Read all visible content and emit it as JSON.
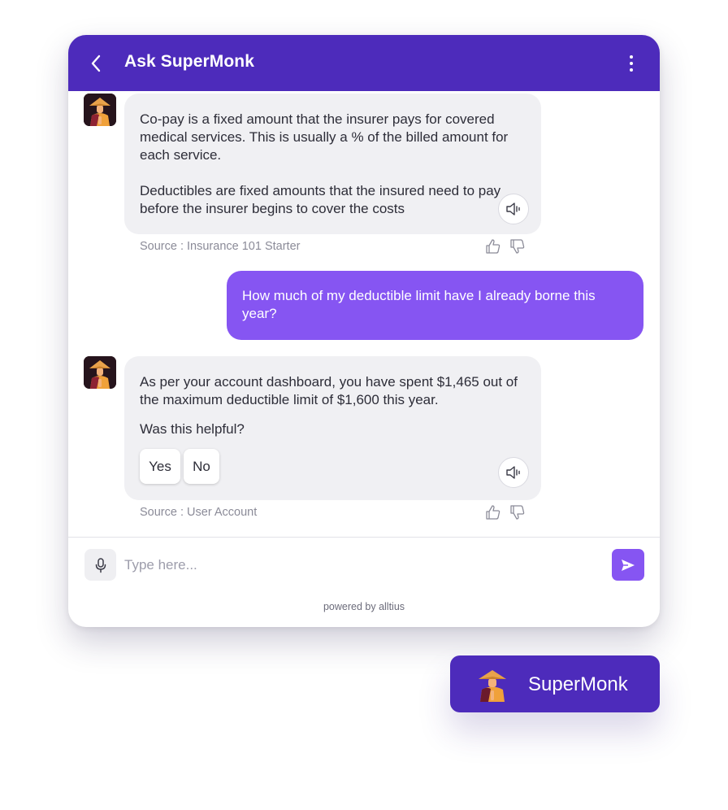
{
  "header": {
    "title": "Ask SuperMonk",
    "back_icon": "chevron-left-icon",
    "menu_icon": "more-vertical-icon",
    "color": "#4d2bbb"
  },
  "messages": [
    {
      "role": "bot",
      "paragraphs": [
        "Co-pay is a fixed amount that the insurer pays for covered medical services. This is usually a % of the billed amount for each service.",
        "Deductibles are fixed amounts that the insured need to pay before the insurer begins to cover the costs"
      ],
      "source": "Source : Insurance 101 Starter"
    },
    {
      "role": "user",
      "text": "How much of my deductible limit have I already borne this year?"
    },
    {
      "role": "bot",
      "text": "As per your account dashboard, you have spent $1,465 out of the maximum deductible limit of $1,600 this year.",
      "question": "Was this helpful?",
      "options": [
        "Yes",
        "No"
      ],
      "source": "Source : User Account"
    }
  ],
  "composer": {
    "placeholder": "Type here...",
    "mic_icon": "microphone-icon",
    "send_icon": "send-icon",
    "send_color": "#8655f2"
  },
  "footer": {
    "powered_by": "powered by alltius"
  },
  "launcher": {
    "label": "SuperMonk",
    "color": "#4d2bbb"
  },
  "colors": {
    "user_bubble": "#8655f2",
    "bot_bubble": "#f0f0f3"
  }
}
